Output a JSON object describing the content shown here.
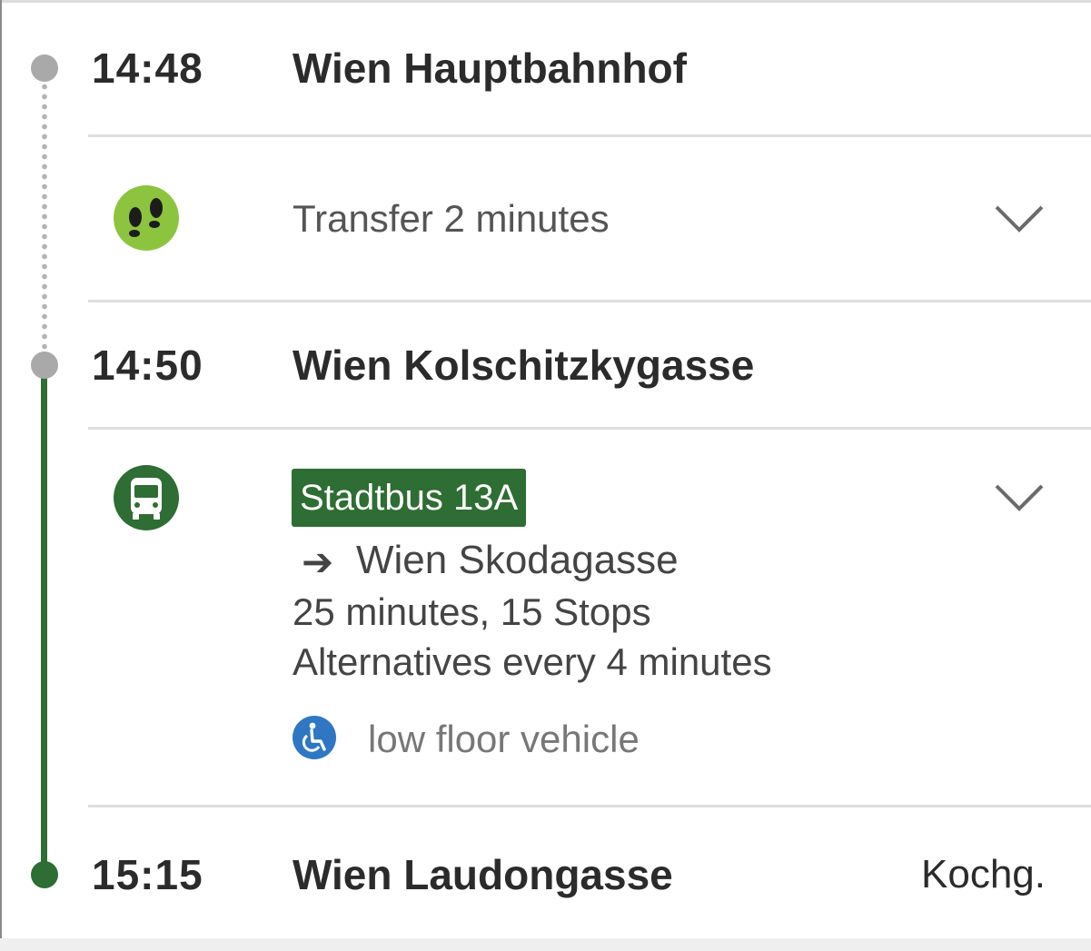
{
  "journey": {
    "stops": [
      {
        "time": "14:48",
        "station": "Wien Hauptbahnhof"
      },
      {
        "time": "14:50",
        "station": "Wien Kolschitzkygasse"
      },
      {
        "time": "15:15",
        "station": "Wien Laudongasse",
        "platform": "Kochg."
      }
    ],
    "transfer": {
      "label": "Transfer 2 minutes",
      "icon": "footsteps-icon"
    },
    "bus_leg": {
      "line": "Stadtbus 13A",
      "direction_arrow": "➔",
      "direction": "Wien Skodagasse",
      "duration_stops": "25 minutes, 15 Stops",
      "alternatives": "Alternatives every 4 minutes",
      "feature": "low floor vehicle",
      "icon": "bus-icon"
    }
  },
  "colors": {
    "line_green": "#2e6d33",
    "walk_green": "#8dc43f",
    "accessibility_blue": "#2f77c3",
    "timeline_grey": "#a9a9a9"
  }
}
